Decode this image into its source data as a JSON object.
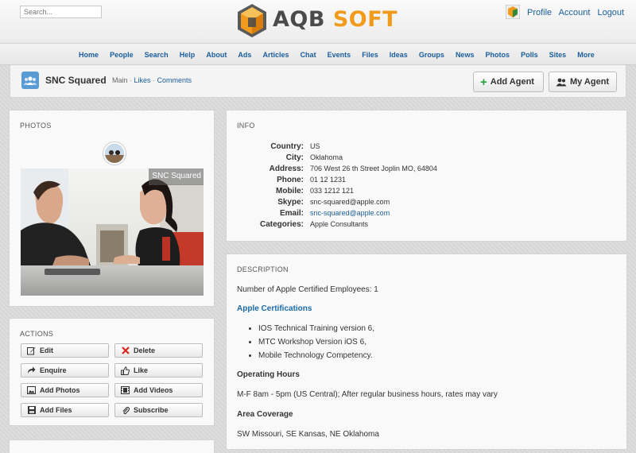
{
  "search": {
    "placeholder": "Search..."
  },
  "brand": {
    "part1": "AQB",
    "part2": " SOFT"
  },
  "top_links": [
    "Profile",
    "Account",
    "Logout"
  ],
  "nav": [
    "Home",
    "People",
    "Search",
    "Help",
    "About",
    "Ads",
    "Articles",
    "Chat",
    "Events",
    "Files",
    "Ideas",
    "Groups",
    "News",
    "Photos",
    "Polls",
    "Sites",
    "More"
  ],
  "header": {
    "title": "SNC Squared",
    "tabs": {
      "main": "Main",
      "sep": " · ",
      "likes": "Likes",
      "comments": "Comments"
    },
    "add_agent": "Add Agent",
    "my_agent": "My Agent"
  },
  "photos": {
    "title": "PHOTOS",
    "caption": "SNC Squared"
  },
  "actions": {
    "title": "ACTIONS",
    "edit": "Edit",
    "delete": "Delete",
    "enquire": "Enquire",
    "like": "Like",
    "add_photos": "Add Photos",
    "add_videos": "Add Videos",
    "add_files": "Add Files",
    "subscribe": "Subscribe"
  },
  "info": {
    "title": "INFO",
    "rows": [
      {
        "label": "Country:",
        "value": "US"
      },
      {
        "label": "City:",
        "value": "Oklahoma"
      },
      {
        "label": "Address:",
        "value": "706 West 26 th Street Joplin MO, 64804"
      },
      {
        "label": "Phone:",
        "value": "01 12 1231"
      },
      {
        "label": "Mobile:",
        "value": "033 1212 121"
      },
      {
        "label": "Skype:",
        "value": "snc-squared@apple.com"
      },
      {
        "label": "Email:",
        "value": "snc-squared@apple.com"
      },
      {
        "label": "Categories:",
        "value": "Apple Consultants"
      }
    ]
  },
  "description": {
    "title": "DESCRIPTION",
    "employees": "Number of Apple Certified Employees: 1",
    "cert_heading": "Apple Certifications",
    "certs": [
      "IOS Technical Training version 6,",
      "MTC Workshop Version iOS 6,",
      "Mobile Technology Competency."
    ],
    "hours_heading": "Operating Hours",
    "hours": "M-F 8am - 5pm (US Central); After regular business hours, rates may vary",
    "coverage_heading": "Area Coverage",
    "coverage": "SW Missouri, SE Kansas, NE Oklahoma"
  },
  "colors": {
    "link": "#1a5d9c",
    "brand_orange": "#f29a1b",
    "add_green": "#2a9d3c",
    "delete_red": "#d9261c"
  }
}
